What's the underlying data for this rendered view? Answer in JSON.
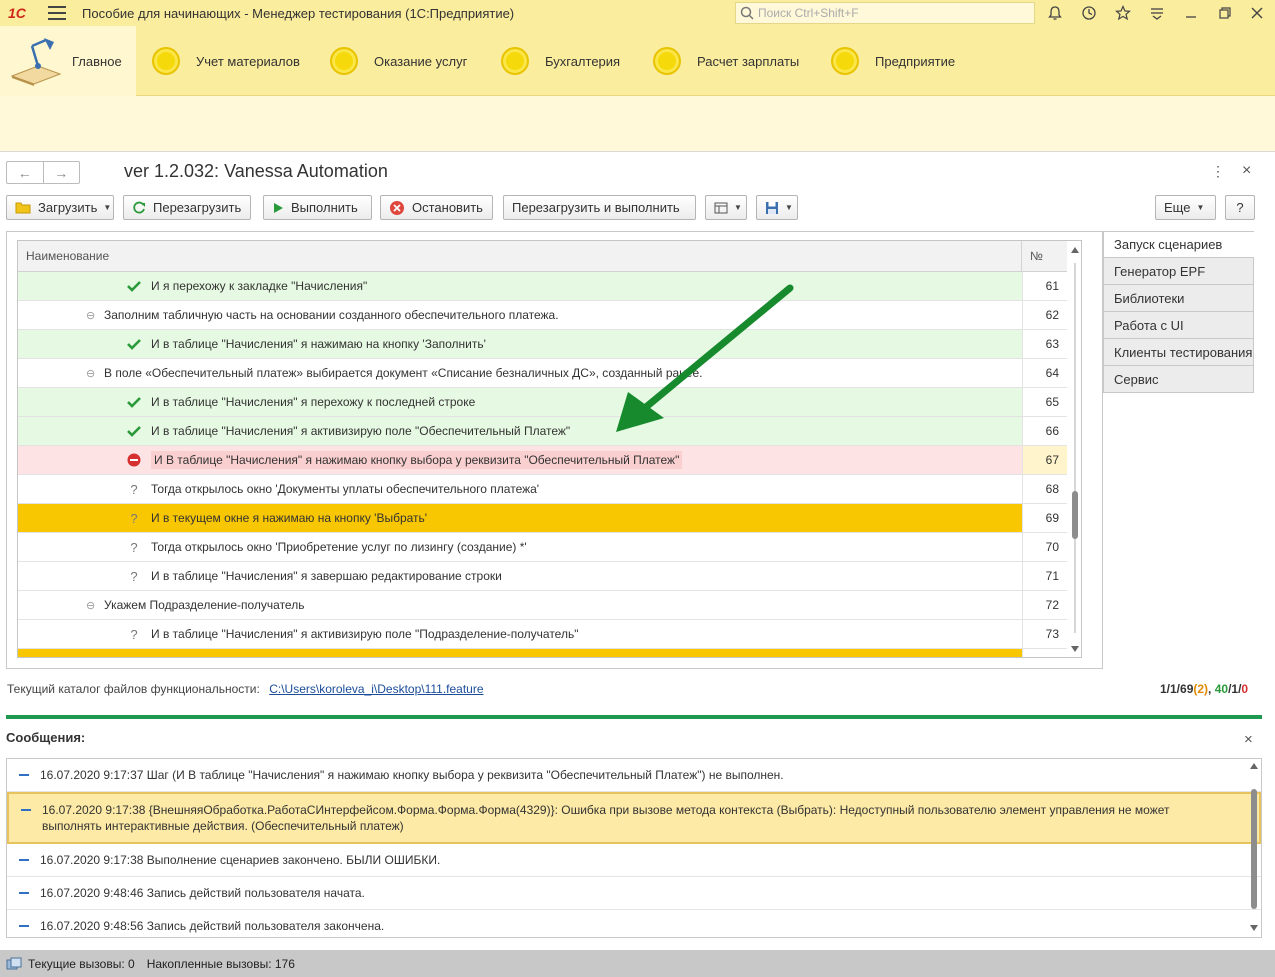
{
  "titlebar": {
    "logo": "1С",
    "title": "Пособие для начинающих  - Менеджер тестирования (1С:Предприятие)",
    "search_placeholder": "Поиск Ctrl+Shift+F"
  },
  "sections": {
    "home": "Главное",
    "items": [
      "Учет материалов",
      "Оказание услуг",
      "Бухгалтерия",
      "Расчет зарплаты",
      "Предприятие"
    ]
  },
  "form": {
    "title": "ver 1.2.032: Vanessa Automation"
  },
  "toolbar": {
    "load": "Загрузить",
    "reload": "Перезагрузить",
    "run": "Выполнить",
    "stop": "Остановить",
    "reload_run": "Перезагрузить и выполнить",
    "more": "Еще",
    "help": "?"
  },
  "grid": {
    "col_name": "Наименование",
    "col_num": "№",
    "rows": [
      {
        "text": "И я перехожу к закладке \"Начисления\"",
        "num": "61"
      },
      {
        "text": "Заполним табличную часть на основании созданного обеспечительного платежа.",
        "num": "62"
      },
      {
        "text": "И в таблице \"Начисления\" я нажимаю на кнопку 'Заполнить'",
        "num": "63"
      },
      {
        "text": "В поле «Обеспечительный платеж» выбирается документ «Списание безналичных ДС», созданный ранее.",
        "num": "64"
      },
      {
        "text": "И в таблице \"Начисления\" я перехожу к последней строке",
        "num": "65"
      },
      {
        "text": "И в таблице \"Начисления\" я активизирую поле \"Обеспечительный Платеж\"",
        "num": "66"
      },
      {
        "text": "И В таблице \"Начисления\" я нажимаю кнопку выбора у реквизита \"Обеспечительный Платеж\"",
        "num": "67"
      },
      {
        "text": "Тогда открылось окно 'Документы уплаты обеспечительного платежа'",
        "num": "68"
      },
      {
        "text": "И в текущем окне я нажимаю на кнопку 'Выбрать'",
        "num": "69"
      },
      {
        "text": "Тогда открылось окно 'Приобретение услуг по лизингу (создание) *'",
        "num": "70"
      },
      {
        "text": "И в таблице \"Начисления\" я завершаю редактирование строки",
        "num": "71"
      },
      {
        "text": "Укажем Подразделение-получатель",
        "num": "72"
      },
      {
        "text": "И в таблице \"Начисления\" я активизирую поле \"Подразделение-получатель\"",
        "num": "73"
      }
    ]
  },
  "right_tabs": [
    "Запуск сценариев",
    "Генератор EPF",
    "Библиотеки",
    "Работа с UI",
    "Клиенты тестирования",
    "Сервис"
  ],
  "path": {
    "label": "Текущий каталог файлов функциональности:",
    "value": "C:\\Users\\koroleva_i\\Desktop\\111.feature"
  },
  "stats": {
    "a": "1/1/69",
    "b": "(2)",
    "sep": ", ",
    "c": "40",
    "d": "/1/",
    "e": "0"
  },
  "messages": {
    "title": "Сообщения:",
    "items": [
      "16.07.2020 9:17:37 Шаг (И В таблице \"Начисления\" я нажимаю кнопку выбора у реквизита \"Обеспечительный Платеж\") не выполнен.",
      "16.07.2020 9:17:38 {ВнешняяОбработка.РаботаСИнтерфейсом.Форма.Форма.Форма(4329)}: Ошибка при вызове метода контекста (Выбрать): Недоступный пользователю элемент управления не может выполнять интерактивные действия. (Обеспечительный платеж)",
      "16.07.2020 9:17:38 Выполнение сценариев закончено. БЫЛИ ОШИБКИ.",
      "16.07.2020 9:48:46 Запись действий пользователя начата.",
      "16.07.2020 9:48:56 Запись действий пользователя закончена."
    ]
  },
  "statusbar": {
    "current_calls": "Текущие вызовы: 0",
    "accum_calls": "Накопленные вызовы: 176"
  },
  "colors": {
    "titlebar": "#fbed9e",
    "row_green": "#e6f9e2",
    "row_red": "#fde3e3",
    "row_selected": "#f8c701",
    "arrow": "#178a2e",
    "divider": "#1e9a50"
  }
}
